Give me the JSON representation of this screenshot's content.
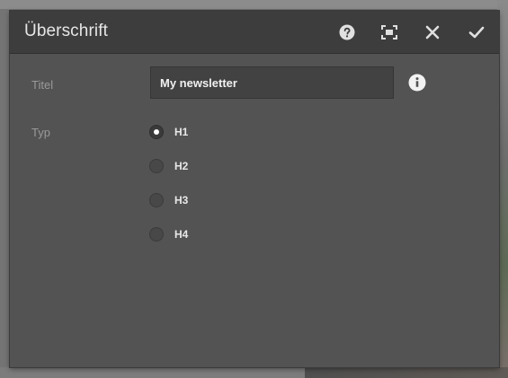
{
  "dialog": {
    "title": "Überschrift",
    "header_icons": [
      "help-icon",
      "fullscreen-icon",
      "close-icon",
      "checkmark-icon"
    ]
  },
  "fields": {
    "title_label": "Titel",
    "title_value": "My newsletter",
    "type_label": "Typ"
  },
  "heading_options": [
    {
      "label": "H1",
      "checked": true
    },
    {
      "label": "H2",
      "checked": false
    },
    {
      "label": "H3",
      "checked": false
    },
    {
      "label": "H4",
      "checked": false
    }
  ],
  "colors": {
    "dialog_bg": "#535353",
    "header_bg": "#3d3d3d",
    "input_bg": "#424242",
    "label_text": "#9a9a9a",
    "icon_color": "#e0e0e0"
  }
}
